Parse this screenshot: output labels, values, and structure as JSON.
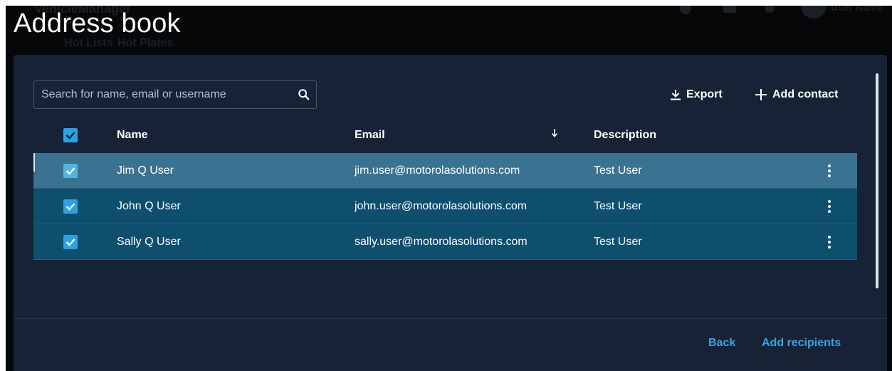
{
  "background": {
    "app_title": "VehicleManager",
    "tabs": [
      "Hot Lists",
      "Hot Plates"
    ],
    "user_label": "User Name"
  },
  "modal": {
    "title": "Address book",
    "search": {
      "placeholder": "Search for name, email or username",
      "value": ""
    },
    "toolbar": {
      "export_label": "Export",
      "add_contact_label": "Add contact"
    },
    "table": {
      "columns": {
        "name": "Name",
        "email": "Email",
        "description": "Description"
      },
      "sort_column": "email",
      "rows": [
        {
          "name": "Jim Q User",
          "email": "jim.user@motorolasolutions.com",
          "description": "Test User",
          "checked": true
        },
        {
          "name": "John Q User",
          "email": "john.user@motorolasolutions.com",
          "description": "Test User",
          "checked": true
        },
        {
          "name": "Sally Q User",
          "email": "sally.user@motorolasolutions.com",
          "description": "Test User",
          "checked": true
        }
      ]
    },
    "footer": {
      "back_label": "Back",
      "add_recipients_label": "Add recipients"
    }
  },
  "colors": {
    "modal_bg": "#172236",
    "row_highlight": "#3a7291",
    "row_normal": "#0e4f6e",
    "accent": "#2aa2e5",
    "link": "#3aa4e2"
  },
  "icons": [
    "search-icon",
    "download-icon",
    "plus-icon",
    "sort-down-icon",
    "more-vert-icon",
    "check-icon"
  ]
}
